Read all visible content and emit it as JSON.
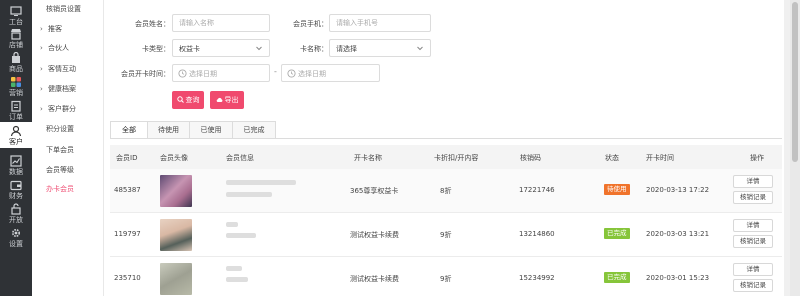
{
  "rail": {
    "items": [
      {
        "label": "工台",
        "icon": "monitor-icon"
      },
      {
        "label": "店铺",
        "icon": "shop-icon"
      },
      {
        "label": "商品",
        "icon": "bag-icon"
      },
      {
        "label": "营销",
        "icon": "grid-color-icon"
      },
      {
        "label": "订单",
        "icon": "clipboard-icon"
      },
      {
        "label": "客户",
        "icon": "user-icon"
      },
      {
        "label": "数据",
        "icon": "chart-icon"
      },
      {
        "label": "财务",
        "icon": "wallet-icon"
      },
      {
        "label": "开放",
        "icon": "open-icon"
      },
      {
        "label": "设置",
        "icon": "gear-icon"
      }
    ]
  },
  "submenu": {
    "items": [
      {
        "label": "核销员设置"
      },
      {
        "label": "推客"
      },
      {
        "label": "合伙人"
      },
      {
        "label": "客情互动"
      },
      {
        "label": "健康档案"
      },
      {
        "label": "客户群分"
      },
      {
        "label": "积分设置"
      },
      {
        "label": "下单会员"
      },
      {
        "label": "会员等级"
      },
      {
        "label": "办卡会员"
      }
    ]
  },
  "filters": {
    "name_label": "会员姓名：",
    "name_placeholder": "请输入名称",
    "phone_label": "会员手机：",
    "phone_placeholder": "请输入手机号",
    "card_type_label": "卡类型：",
    "card_type_value": "权益卡",
    "card_name_label": "卡名称：",
    "card_name_value": "请选择",
    "open_time_label": "会员开卡时间：",
    "start_date": "选择日期",
    "end_date": "选择日期",
    "dash": "-",
    "search_label": "查询",
    "export_label": "导出"
  },
  "tabs": [
    {
      "label": "全部"
    },
    {
      "label": "待使用"
    },
    {
      "label": "已使用"
    },
    {
      "label": "已完成"
    }
  ],
  "table": {
    "headers": [
      "会员ID",
      "会员头像",
      "会员信息",
      "开卡名称",
      "卡折扣/开内容",
      "核销码",
      "状态",
      "开卡时间",
      "操作"
    ],
    "rows": [
      {
        "id": "485387",
        "card_name": "365尊享权益卡",
        "discount": "8折",
        "code": "17221746",
        "status": "待使用",
        "status_color": "#f0732b",
        "time": "2020-03-13 17:22",
        "action1": "详情",
        "action2": "核销记录"
      },
      {
        "id": "119797",
        "card_name": "测试权益卡续费",
        "discount": "9折",
        "code": "13214860",
        "status": "已完成",
        "status_color": "#86c53a",
        "time": "2020-03-03 13:21",
        "action1": "详情",
        "action2": "核销记录"
      },
      {
        "id": "235710",
        "card_name": "测试权益卡续费",
        "discount": "9折",
        "code": "15234992",
        "status": "已完成",
        "status_color": "#86c53a",
        "time": "2020-03-01 15:23",
        "action1": "详情",
        "action2": "核销记录"
      }
    ]
  }
}
